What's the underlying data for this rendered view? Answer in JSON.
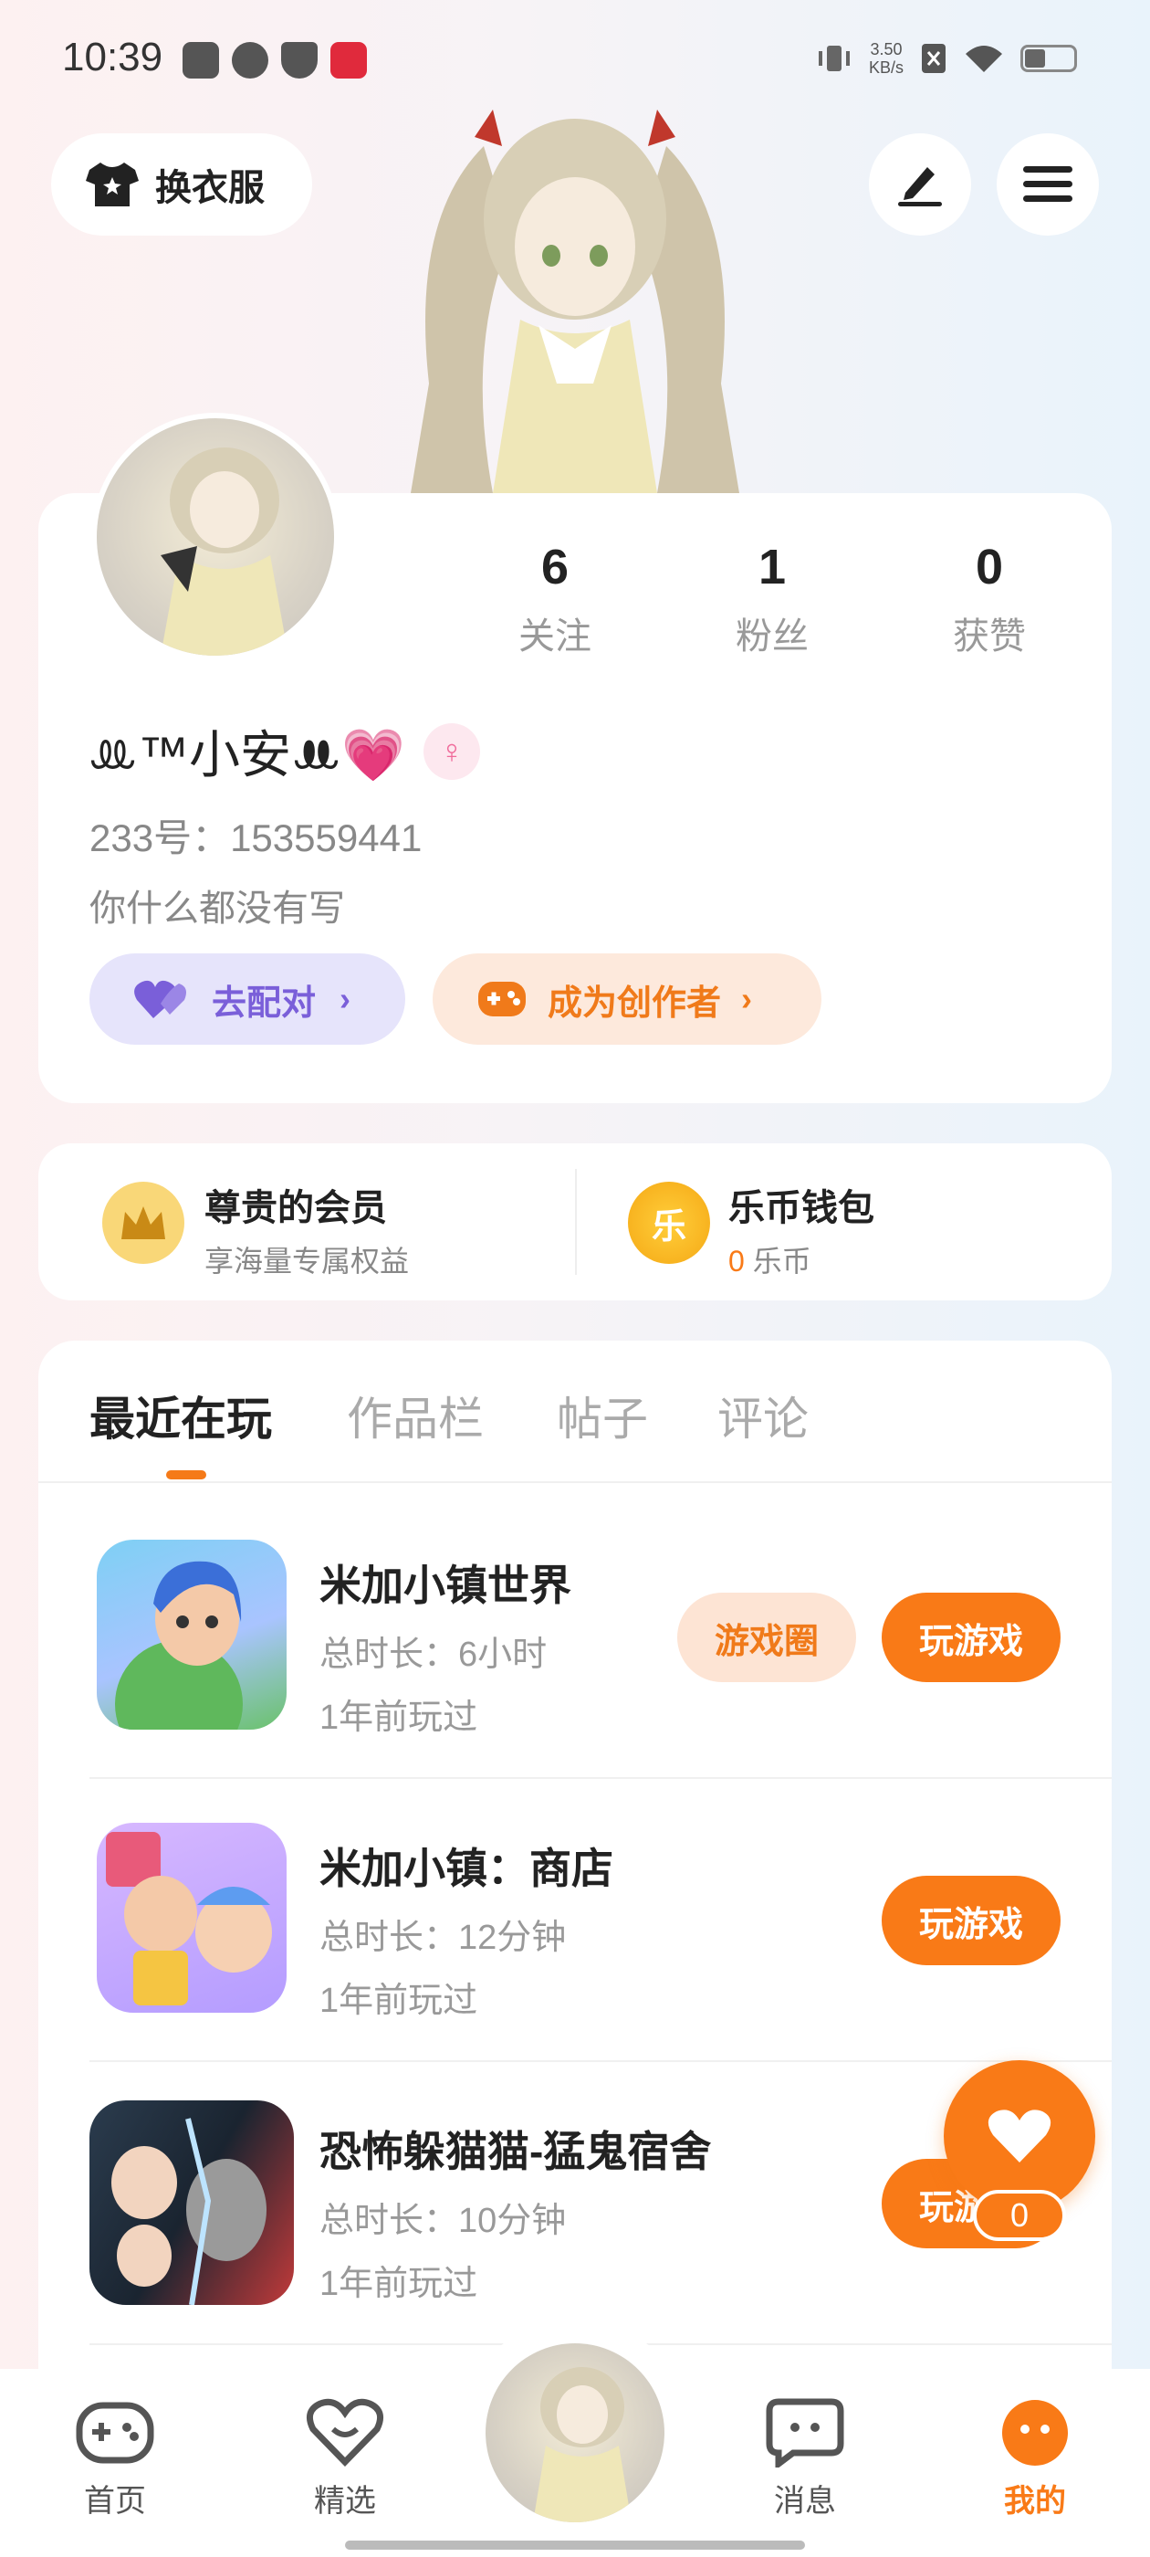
{
  "status_bar": {
    "time": "10:39",
    "speed_value": "3.50",
    "speed_unit": "KB/s",
    "icons": [
      "scan-icon",
      "speedometer-icon",
      "shield-icon",
      "xiaohongshu-icon",
      "vibrate-icon",
      "no-sim-icon",
      "wifi-icon",
      "battery-icon"
    ]
  },
  "top": {
    "outfit_label": "换衣服",
    "edit_icon": "edit-icon",
    "menu_icon": "menu-icon"
  },
  "profile": {
    "stats": [
      {
        "value": "6",
        "label": "关注"
      },
      {
        "value": "1",
        "label": "粉丝"
      },
      {
        "value": "0",
        "label": "获赞"
      }
    ],
    "nickname": "ꔛ™小安ꔚ💗",
    "gender_symbol": "♀",
    "uid": "233号：153559441",
    "bio": "你什么都没有写",
    "pair_label": "去配对",
    "creator_label": "成为创作者"
  },
  "member": {
    "vip_title": "尊贵的会员",
    "vip_sub": "享海量专属权益",
    "wallet_title": "乐币钱包",
    "wallet_amount": "0",
    "wallet_unit": "乐币",
    "coin_char": "乐"
  },
  "tabs": [
    "最近在玩",
    "作品栏",
    "帖子",
    "评论"
  ],
  "games": [
    {
      "name": "米加小镇世界",
      "duration": "总时长：6小时",
      "last_played": "1年前玩过",
      "circle_label": "游戏圈",
      "play_label": "玩游戏"
    },
    {
      "name": "米加小镇：商店",
      "duration": "总时长：12分钟",
      "last_played": "1年前玩过",
      "play_label": "玩游戏"
    },
    {
      "name": "恐怖躲猫猫-猛鬼宿舍",
      "duration": "总时长：10分钟",
      "last_played": "1年前玩过",
      "play_label": "玩游戏"
    }
  ],
  "fab": {
    "count": "0"
  },
  "nav": [
    {
      "label": "首页"
    },
    {
      "label": "精选"
    },
    {
      "label": "消息"
    },
    {
      "label": "我的"
    }
  ],
  "colors": {
    "accent": "#f97a17",
    "purple": "#7a5fd9",
    "gold": "#f9d778"
  }
}
